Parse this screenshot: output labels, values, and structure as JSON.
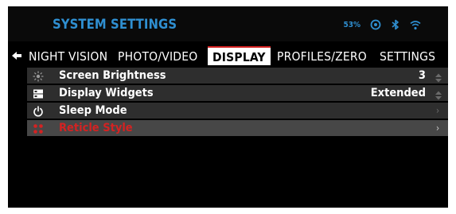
{
  "header": {
    "title": "SYSTEM SETTINGS",
    "battery": "53%",
    "icons": [
      "recording-icon",
      "bluetooth-icon",
      "wifi-icon"
    ]
  },
  "tabs": [
    {
      "label": "NIGHT VISION",
      "active": false
    },
    {
      "label": "PHOTO/VIDEO",
      "active": false
    },
    {
      "label": "DISPLAY",
      "active": true
    },
    {
      "label": "PROFILES/ZERO",
      "active": false
    },
    {
      "label": "SETTINGS",
      "active": false
    }
  ],
  "menu": {
    "items": [
      {
        "label": "Screen Brightness",
        "value": "3",
        "icon": "brightness-icon",
        "control": "up-down-arrows"
      },
      {
        "label": "Display Widgets",
        "value": "Extended",
        "icon": "widgets-icon",
        "control": "up-down-arrows"
      },
      {
        "label": "Sleep Mode",
        "value": "",
        "icon": "power-icon",
        "control": "chevron-right"
      },
      {
        "label": "Reticle Style",
        "value": "",
        "icon": "reticle-icon",
        "control": "chevron-right",
        "selected": true
      }
    ]
  },
  "colors": {
    "accent_blue": "#2f8fd1",
    "selected_red": "#d42222",
    "tab_active_border": "#d12020",
    "row_bg": "#2e2e2e",
    "row_selected_bg": "#474747"
  }
}
